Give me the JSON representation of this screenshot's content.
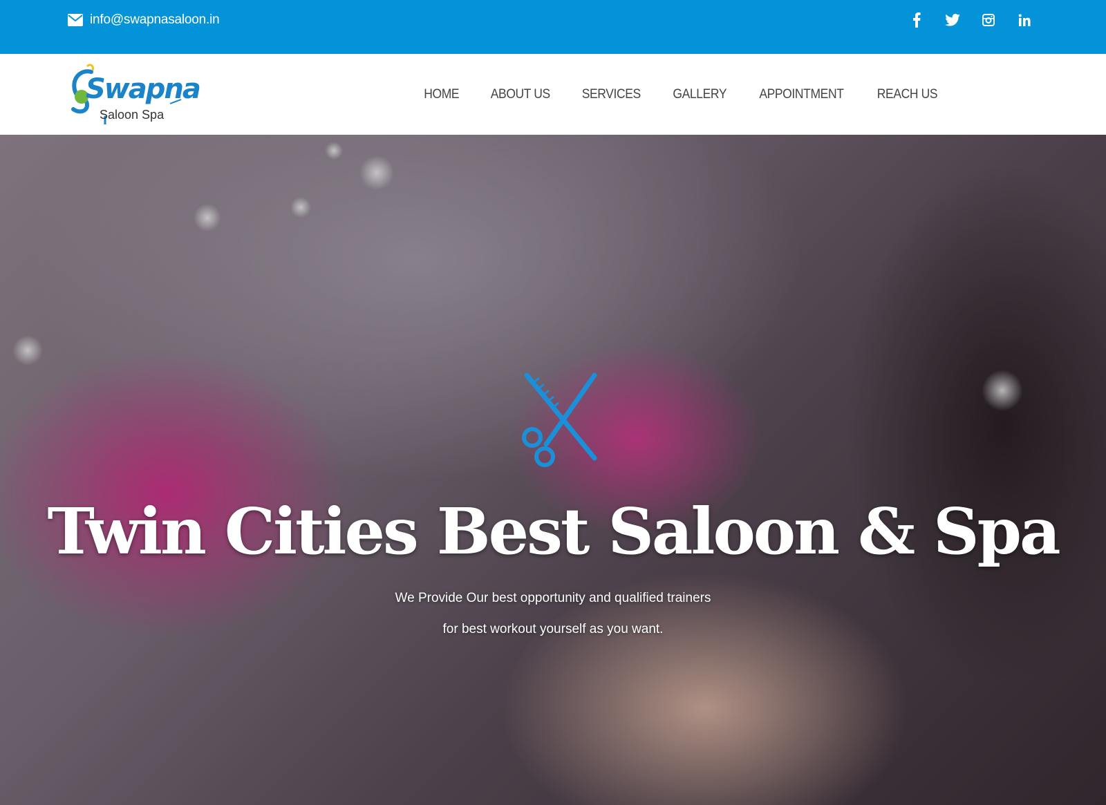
{
  "topbar": {
    "email": "info@swapnasaloon.in",
    "social": [
      {
        "icon": "facebook-icon"
      },
      {
        "icon": "twitter-icon"
      },
      {
        "icon": "instagram-icon"
      },
      {
        "icon": "linkedin-icon"
      }
    ],
    "background_color": "#0493d9"
  },
  "header": {
    "logo": {
      "brand": "Swapna",
      "sub": "Saloon Spa"
    },
    "nav": [
      {
        "label": "HOME"
      },
      {
        "label": "ABOUT US"
      },
      {
        "label": "SERVICES"
      },
      {
        "label": "GALLERY"
      },
      {
        "label": "APPOINTMENT"
      },
      {
        "label": "REACH US"
      }
    ]
  },
  "hero": {
    "emblem_icon": "comb-scissors-icon",
    "title": "Twin Cities Best Saloon & Spa",
    "subtitle_line1": "We Provide Our best opportunity and qualified trainers",
    "subtitle_line2": "for best workout yourself as you want."
  },
  "colors": {
    "accent": "#0493d9",
    "nav_text": "#444444"
  }
}
